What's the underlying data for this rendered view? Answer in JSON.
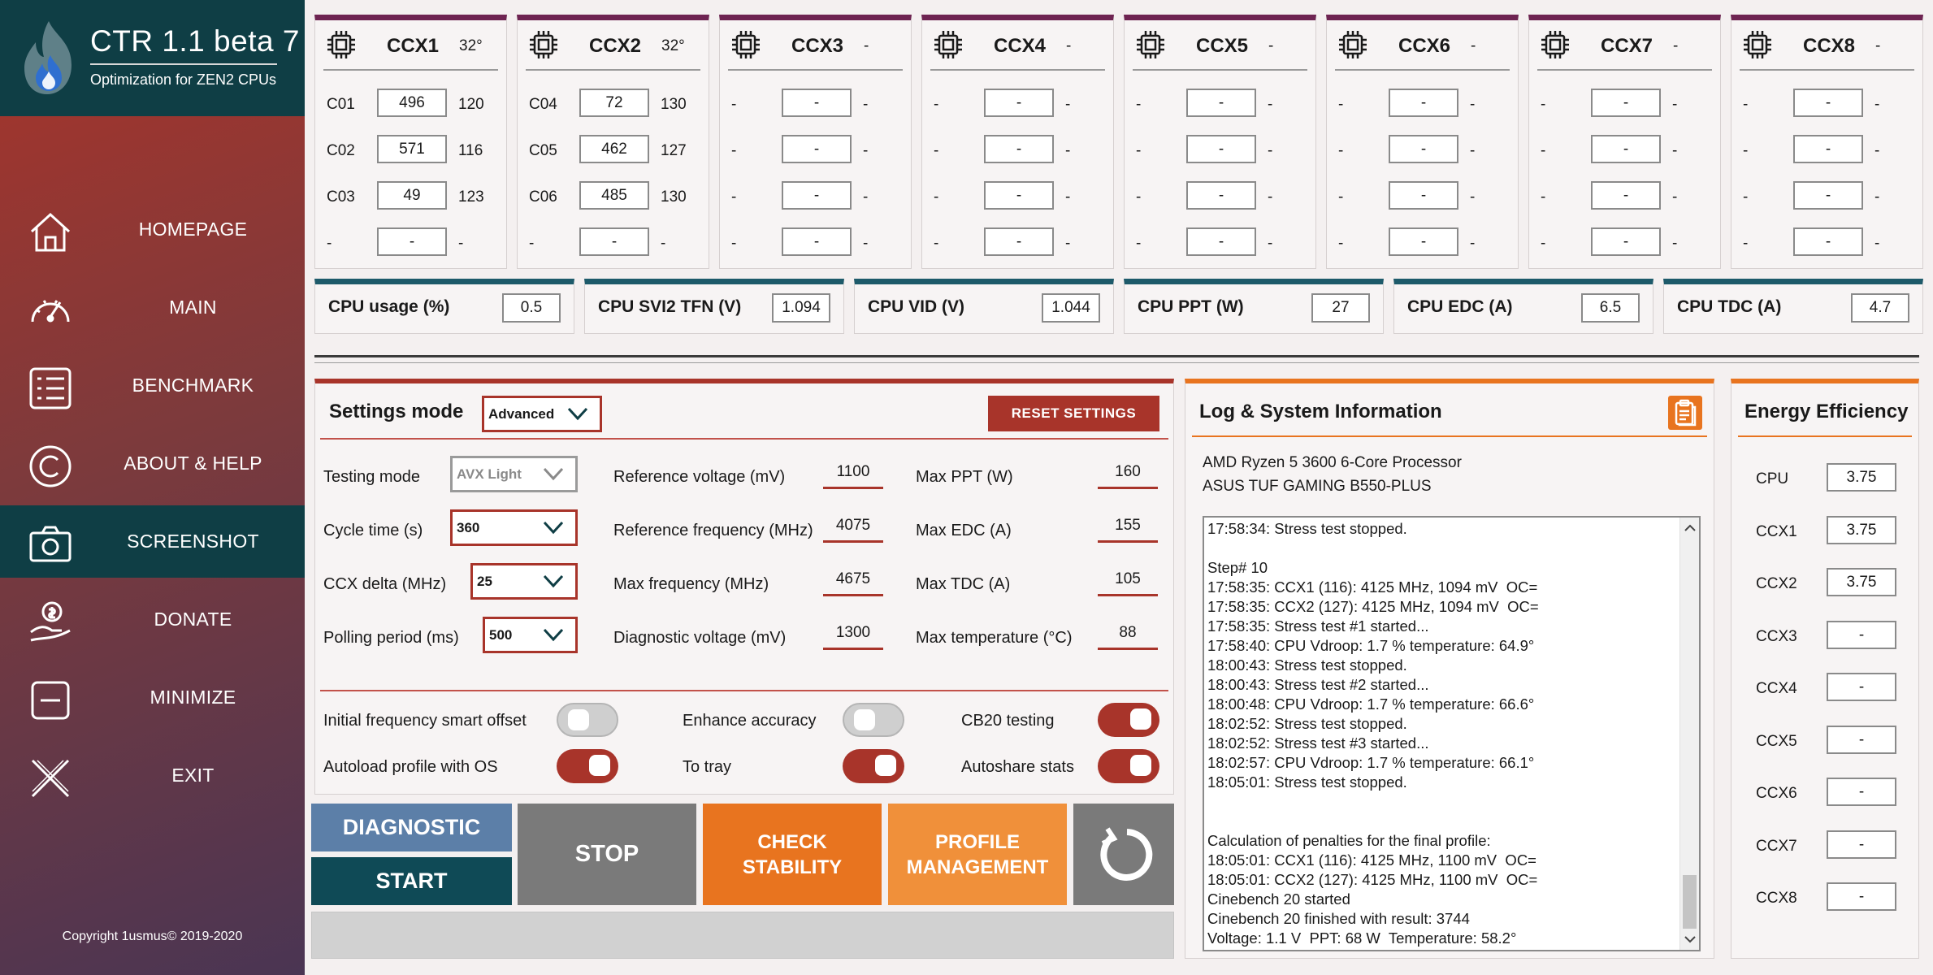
{
  "app": {
    "title": "CTR 1.1 beta 7",
    "subtitle": "Optimization for ZEN2 CPUs",
    "copyright": "Copyright 1usmus© 2019-2020"
  },
  "nav": [
    {
      "label": "HOMEPAGE",
      "icon": "home-icon"
    },
    {
      "label": "MAIN",
      "icon": "speedometer-icon"
    },
    {
      "label": "BENCHMARK",
      "icon": "list-icon"
    },
    {
      "label": "ABOUT & HELP",
      "icon": "copyright-icon"
    },
    {
      "label": "SCREENSHOT",
      "icon": "camera-icon",
      "active": true
    },
    {
      "label": "DONATE",
      "icon": "donate-hand-icon"
    },
    {
      "label": "MINIMIZE",
      "icon": "minimize-icon"
    },
    {
      "label": "EXIT",
      "icon": "close-icon"
    }
  ],
  "ccx": [
    {
      "name": "CCX1",
      "temp": "32°",
      "cores": [
        {
          "id": "C01",
          "freq": "496",
          "val": "120"
        },
        {
          "id": "C02",
          "freq": "571",
          "val": "116"
        },
        {
          "id": "C03",
          "freq": "49",
          "val": "123"
        },
        {
          "id": "-",
          "freq": "-",
          "val": "-"
        }
      ]
    },
    {
      "name": "CCX2",
      "temp": "32°",
      "cores": [
        {
          "id": "C04",
          "freq": "72",
          "val": "130"
        },
        {
          "id": "C05",
          "freq": "462",
          "val": "127"
        },
        {
          "id": "C06",
          "freq": "485",
          "val": "130"
        },
        {
          "id": "-",
          "freq": "-",
          "val": "-"
        }
      ]
    },
    {
      "name": "CCX3",
      "temp": "-",
      "cores": [
        {
          "id": "-",
          "freq": "-",
          "val": "-"
        },
        {
          "id": "-",
          "freq": "-",
          "val": "-"
        },
        {
          "id": "-",
          "freq": "-",
          "val": "-"
        },
        {
          "id": "-",
          "freq": "-",
          "val": "-"
        }
      ]
    },
    {
      "name": "CCX4",
      "temp": "-",
      "cores": [
        {
          "id": "-",
          "freq": "-",
          "val": "-"
        },
        {
          "id": "-",
          "freq": "-",
          "val": "-"
        },
        {
          "id": "-",
          "freq": "-",
          "val": "-"
        },
        {
          "id": "-",
          "freq": "-",
          "val": "-"
        }
      ]
    },
    {
      "name": "CCX5",
      "temp": "-",
      "cores": [
        {
          "id": "-",
          "freq": "-",
          "val": "-"
        },
        {
          "id": "-",
          "freq": "-",
          "val": "-"
        },
        {
          "id": "-",
          "freq": "-",
          "val": "-"
        },
        {
          "id": "-",
          "freq": "-",
          "val": "-"
        }
      ]
    },
    {
      "name": "CCX6",
      "temp": "-",
      "cores": [
        {
          "id": "-",
          "freq": "-",
          "val": "-"
        },
        {
          "id": "-",
          "freq": "-",
          "val": "-"
        },
        {
          "id": "-",
          "freq": "-",
          "val": "-"
        },
        {
          "id": "-",
          "freq": "-",
          "val": "-"
        }
      ]
    },
    {
      "name": "CCX7",
      "temp": "-",
      "cores": [
        {
          "id": "-",
          "freq": "-",
          "val": "-"
        },
        {
          "id": "-",
          "freq": "-",
          "val": "-"
        },
        {
          "id": "-",
          "freq": "-",
          "val": "-"
        },
        {
          "id": "-",
          "freq": "-",
          "val": "-"
        }
      ]
    },
    {
      "name": "CCX8",
      "temp": "-",
      "cores": [
        {
          "id": "-",
          "freq": "-",
          "val": "-"
        },
        {
          "id": "-",
          "freq": "-",
          "val": "-"
        },
        {
          "id": "-",
          "freq": "-",
          "val": "-"
        },
        {
          "id": "-",
          "freq": "-",
          "val": "-"
        }
      ]
    }
  ],
  "stats": [
    {
      "label": "CPU usage (%)",
      "value": "0.5"
    },
    {
      "label": "CPU SVI2 TFN (V)",
      "value": "1.094"
    },
    {
      "label": "CPU VID (V)",
      "value": "1.044"
    },
    {
      "label": "CPU PPT (W)",
      "value": "27"
    },
    {
      "label": "CPU EDC (A)",
      "value": "6.5"
    },
    {
      "label": "CPU TDC (A)",
      "value": "4.7"
    }
  ],
  "settings": {
    "title": "Settings mode",
    "mode": "Advanced",
    "reset_label": "RESET SETTINGS",
    "testing_mode": {
      "label": "Testing mode",
      "value": "AVX Light"
    },
    "cycle_time": {
      "label": "Cycle time (s)",
      "value": "360"
    },
    "ccx_delta": {
      "label": "CCX delta (MHz)",
      "value": "25"
    },
    "polling_period": {
      "label": "Polling period (ms)",
      "value": "500"
    },
    "ref_voltage": {
      "label": "Reference voltage (mV)",
      "value": "1100"
    },
    "ref_frequency": {
      "label": "Reference frequency (MHz)",
      "value": "4075"
    },
    "max_frequency": {
      "label": "Max frequency (MHz)",
      "value": "4675"
    },
    "diag_voltage": {
      "label": "Diagnostic voltage (mV)",
      "value": "1300"
    },
    "max_ppt": {
      "label": "Max PPT (W)",
      "value": "160"
    },
    "max_edc": {
      "label": "Max EDC (A)",
      "value": "155"
    },
    "max_tdc": {
      "label": "Max TDC (A)",
      "value": "105"
    },
    "max_temp": {
      "label": "Max temperature (°C)",
      "value": "88"
    },
    "toggles": {
      "smart_offset": {
        "label": "Initial frequency smart offset",
        "on": false
      },
      "enhance_accuracy": {
        "label": "Enhance accuracy",
        "on": false
      },
      "cb20": {
        "label": "CB20 testing",
        "on": true
      },
      "autoload": {
        "label": "Autoload profile with OS",
        "on": true
      },
      "to_tray": {
        "label": "To tray",
        "on": true
      },
      "autoshare": {
        "label": "Autoshare stats",
        "on": true
      }
    }
  },
  "actions": {
    "diagnostic": "DIAGNOSTIC",
    "start": "START",
    "stop": "STOP",
    "check_stability": [
      "CHECK",
      "STABILITY"
    ],
    "profile_management": [
      "PROFILE",
      "MANAGEMENT"
    ]
  },
  "log": {
    "title": "Log & System Information",
    "cpu": "AMD Ryzen 5 3600 6-Core Processor",
    "board": "ASUS TUF GAMING B550-PLUS",
    "lines": [
      "17:58:34: Stress test stopped.",
      "",
      "Step# 10",
      "17:58:35: CCX1 (116): 4125 MHz, 1094 mV  OC=",
      "17:58:35: CCX2 (127): 4125 MHz, 1094 mV  OC=",
      "17:58:35: Stress test #1 started...",
      "17:58:40: CPU Vdroop: 1.7 % temperature: 64.9°",
      "18:00:43: Stress test stopped.",
      "18:00:43: Stress test #2 started...",
      "18:00:48: CPU Vdroop: 1.7 % temperature: 66.6°",
      "18:02:52: Stress test stopped.",
      "18:02:52: Stress test #3 started...",
      "18:02:57: CPU Vdroop: 1.7 % temperature: 66.1°",
      "18:05:01: Stress test stopped.",
      "",
      "",
      "Calculation of penalties for the final profile:",
      "18:05:01: CCX1 (116): 4125 MHz, 1100 mV  OC=",
      "18:05:01: CCX2 (127): 4125 MHz, 1100 mV  OC=",
      "Cinebench 20 started",
      "Cinebench 20 finished with result: 3744",
      "Voltage: 1.1 V  PPT: 68 W  Temperature: 58.2°"
    ]
  },
  "energy": {
    "title": "Energy Efficiency",
    "rows": [
      {
        "label": "CPU",
        "value": "3.75"
      },
      {
        "label": "CCX1",
        "value": "3.75"
      },
      {
        "label": "CCX2",
        "value": "3.75"
      },
      {
        "label": "CCX3",
        "value": "-"
      },
      {
        "label": "CCX4",
        "value": "-"
      },
      {
        "label": "CCX5",
        "value": "-"
      },
      {
        "label": "CCX6",
        "value": "-"
      },
      {
        "label": "CCX7",
        "value": "-"
      },
      {
        "label": "CCX8",
        "value": "-"
      }
    ]
  },
  "colors": {
    "accent": "#a8342a",
    "teal": "#0f3e45",
    "orange": "#e8741f",
    "orange_light": "#f0903a",
    "ccx_bar": "#6e2452",
    "stat_bar": "#1d5a6a",
    "gray_btn": "#7a7a7a",
    "blue_btn": "#5c7fa8"
  }
}
